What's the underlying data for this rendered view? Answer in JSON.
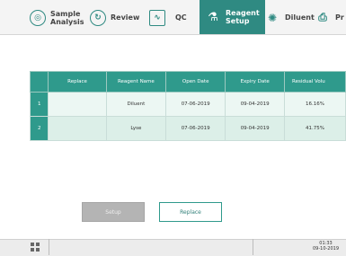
{
  "tabs": [
    {
      "label1": "Sample",
      "label2": "Analysis",
      "icon": "sample-icon"
    },
    {
      "label1": "Review",
      "label2": "",
      "icon": "review-icon"
    },
    {
      "label1": "QC",
      "label2": "",
      "icon": "qc-icon"
    },
    {
      "label1": "Reagent",
      "label2": "Setup",
      "icon": "reagent-icon",
      "active": true
    },
    {
      "label1": "Diluent",
      "label2": "",
      "icon": "diluent-icon"
    },
    {
      "label1": "Pr",
      "label2": "",
      "icon": "printer-icon"
    }
  ],
  "table": {
    "headers": [
      "",
      "Replace",
      "Reagent Name",
      "Open Date",
      "Expiry Date",
      "Residual Volu"
    ],
    "rows": [
      {
        "index": "1",
        "replace": "",
        "name": "Diluent",
        "open": "07-06-2019",
        "expiry": "09-04-2019",
        "residual": "16.16%"
      },
      {
        "index": "2",
        "replace": "",
        "name": "Lyse",
        "open": "07-06-2019",
        "expiry": "09-04-2019",
        "residual": "41.75%"
      }
    ]
  },
  "buttons": {
    "setup": "Setup",
    "replace": "Replace"
  },
  "status": {
    "time": "01:33",
    "date": "09-10-2019"
  },
  "colors": {
    "accent": "#2f9a8c",
    "accent_dark": "#2f8a82"
  }
}
